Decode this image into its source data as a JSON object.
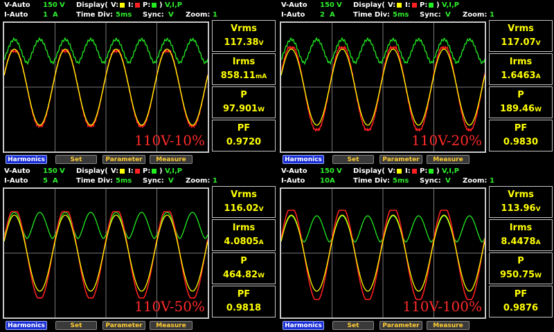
{
  "colors": {
    "voltage": "#ffff00",
    "current": "#ff2020",
    "power": "#22ee22",
    "label_accent": "#ffff00"
  },
  "panels": [
    {
      "v_range": "150",
      "v_unit": "V",
      "i_range": "1",
      "i_unit": "A",
      "display_label": "Display(",
      "display_v": "V:",
      "display_i": "I:",
      "display_p": "P:",
      "display_set": "V,I,P",
      "time_div_label": "Time  Div:",
      "time_div": "5ms",
      "sync_label": "Sync:",
      "sync": "V",
      "zoom_label": "Zoom:",
      "zoom": "1",
      "v_mode": "V-Auto",
      "i_mode": "I-Auto",
      "vrms_label": "Vrms",
      "vrms": "117.38",
      "vrms_unit": "V",
      "irms_label": "Irms",
      "irms": "858.11",
      "irms_unit": "mA",
      "p_label": "P",
      "p": "97.901",
      "p_unit": "W",
      "pf_label": "PF",
      "pf": "0.9720",
      "tag": "110V-10%",
      "buttons": {
        "harmonics": "Harmonics",
        "set": "Set",
        "parameter": "Parameter",
        "measure": "Measure"
      }
    },
    {
      "v_range": "150",
      "v_unit": "V",
      "i_range": "2",
      "i_unit": "A",
      "display_label": "Display(",
      "display_v": "V:",
      "display_i": "I:",
      "display_p": "P:",
      "display_set": "V,I,P",
      "time_div_label": "Time  Div:",
      "time_div": "5ms",
      "sync_label": "Sync:",
      "sync": "V",
      "zoom_label": "Zoom:",
      "zoom": "1",
      "v_mode": "V-Auto",
      "i_mode": "I-Auto",
      "vrms_label": "Vrms",
      "vrms": "117.07",
      "vrms_unit": "V",
      "irms_label": "Irms",
      "irms": "1.6463",
      "irms_unit": "A",
      "p_label": "P",
      "p": "189.46",
      "p_unit": "W",
      "pf_label": "PF",
      "pf": "0.9830",
      "tag": "110V-20%",
      "buttons": {
        "harmonics": "Harmonics",
        "set": "Set",
        "parameter": "Parameter",
        "measure": "Measure"
      }
    },
    {
      "v_range": "150",
      "v_unit": "V",
      "i_range": "5",
      "i_unit": "A",
      "display_label": "Display(",
      "display_v": "V:",
      "display_i": "I:",
      "display_p": "P:",
      "display_set": "V,I,P",
      "time_div_label": "Time  Div:",
      "time_div": "5ms",
      "sync_label": "Sync:",
      "sync": "V",
      "zoom_label": "Zoom:",
      "zoom": "1",
      "v_mode": "V-Auto",
      "i_mode": "I-Auto",
      "vrms_label": "Vrms",
      "vrms": "116.02",
      "vrms_unit": "V",
      "irms_label": "Irms",
      "irms": "4.0805",
      "irms_unit": "A",
      "p_label": "P",
      "p": "464.82",
      "p_unit": "W",
      "pf_label": "PF",
      "pf": "0.9818",
      "tag": "110V-50%",
      "buttons": {
        "harmonics": "Harmonics",
        "set": "Set",
        "parameter": "Parameter",
        "measure": "Measure"
      }
    },
    {
      "v_range": "150",
      "v_unit": "V",
      "i_range": "10",
      "i_unit": "A",
      "display_label": "Display(",
      "display_v": "V:",
      "display_i": "I:",
      "display_p": "P:",
      "display_set": "V,I,P",
      "time_div_label": "Time  Div:",
      "time_div": "5ms",
      "sync_label": "Sync:",
      "sync": "V",
      "zoom_label": "Zoom:",
      "zoom": "1",
      "v_mode": "V-Auto",
      "i_mode": "I-Auto",
      "vrms_label": "Vrms",
      "vrms": "113.96",
      "vrms_unit": "V",
      "irms_label": "Irms",
      "irms": "8.4478",
      "irms_unit": "A",
      "p_label": "P",
      "p": "950.75",
      "p_unit": "W",
      "pf_label": "PF",
      "pf": "0.9876",
      "tag": "110V-100%",
      "buttons": {
        "harmonics": "Harmonics",
        "set": "Set",
        "parameter": "Parameter",
        "measure": "Measure"
      }
    }
  ]
}
